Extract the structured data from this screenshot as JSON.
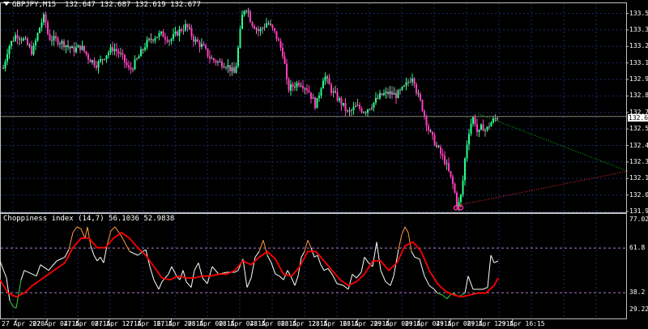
{
  "main_header": {
    "symbol": "GBPJPY,M15",
    "ohlc": "132.647 132.687 132.619 132.677"
  },
  "sub_header": {
    "indicator": "Choppiness index (14,7) 56.1036 52.9838"
  },
  "current_price": "132.677",
  "chart_data": [
    {
      "type": "candlestick",
      "title": "GBPJPY,M15",
      "y_ticks": [
        "133.520",
        "133.385",
        "133.250",
        "133.115",
        "132.980",
        "132.845",
        "132.710",
        "132.575",
        "132.440",
        "132.305",
        "132.170",
        "132.035",
        "131.900"
      ],
      "ylim": [
        131.9,
        133.59
      ],
      "approx_close_path": [
        [
          0,
          132.96
        ],
        [
          10,
          133.24
        ],
        [
          20,
          133.35
        ],
        [
          30,
          133.3
        ],
        [
          40,
          133.2
        ],
        [
          50,
          133.43
        ],
        [
          55,
          133.5
        ],
        [
          60,
          133.32
        ],
        [
          70,
          133.3
        ],
        [
          80,
          133.27
        ],
        [
          90,
          133.22
        ],
        [
          100,
          133.25
        ],
        [
          110,
          133.15
        ],
        [
          120,
          133.1
        ],
        [
          130,
          133.18
        ],
        [
          140,
          133.24
        ],
        [
          150,
          133.17
        ],
        [
          160,
          133.05
        ],
        [
          170,
          133.15
        ],
        [
          180,
          133.27
        ],
        [
          190,
          133.33
        ],
        [
          200,
          133.35
        ],
        [
          210,
          133.3
        ],
        [
          220,
          133.37
        ],
        [
          230,
          133.42
        ],
        [
          240,
          133.3
        ],
        [
          250,
          133.25
        ],
        [
          260,
          133.15
        ],
        [
          270,
          133.12
        ],
        [
          280,
          133.1
        ],
        [
          290,
          133.02
        ],
        [
          300,
          133.55
        ],
        [
          305,
          133.57
        ],
        [
          310,
          133.45
        ],
        [
          320,
          133.37
        ],
        [
          330,
          133.45
        ],
        [
          340,
          133.35
        ],
        [
          350,
          133.18
        ],
        [
          355,
          132.9
        ],
        [
          360,
          132.92
        ],
        [
          370,
          132.96
        ],
        [
          380,
          132.9
        ],
        [
          390,
          132.76
        ],
        [
          400,
          133.02
        ],
        [
          410,
          132.88
        ],
        [
          420,
          132.8
        ],
        [
          430,
          132.7
        ],
        [
          440,
          132.76
        ],
        [
          450,
          132.72
        ],
        [
          460,
          132.78
        ],
        [
          470,
          132.85
        ],
        [
          480,
          132.87
        ],
        [
          490,
          132.85
        ],
        [
          500,
          132.92
        ],
        [
          510,
          133.02
        ],
        [
          515,
          132.86
        ],
        [
          520,
          132.78
        ],
        [
          530,
          132.55
        ],
        [
          540,
          132.42
        ],
        [
          550,
          132.3
        ],
        [
          560,
          132.1
        ],
        [
          565,
          131.93
        ],
        [
          570,
          132.05
        ],
        [
          575,
          132.4
        ],
        [
          580,
          132.6
        ],
        [
          585,
          132.68
        ],
        [
          590,
          132.52
        ],
        [
          595,
          132.6
        ],
        [
          600,
          132.56
        ],
        [
          605,
          132.62
        ],
        [
          610,
          132.65
        ],
        [
          615,
          132.68
        ]
      ],
      "trendlines": [
        {
          "color": "#00cc00",
          "style": "dotted",
          "from": [
            590,
            132.7
          ],
          "to": [
            775,
            132.23
          ]
        },
        {
          "color": "#ff3333",
          "style": "dotted",
          "from": [
            565,
            131.95
          ],
          "to": [
            775,
            132.23
          ]
        }
      ],
      "markers": [
        {
          "x": 563,
          "y": 131.93,
          "color": "#ff2d9b"
        },
        {
          "x": 569,
          "y": 131.93,
          "color": "#ff2d9b"
        }
      ]
    },
    {
      "type": "line",
      "title": "Choppiness index (14,7)",
      "y_ticks": [
        "77.0261",
        "61.8",
        "38.2",
        "29.2276"
      ],
      "ylim": [
        25.0,
        79.0
      ],
      "levels": [
        61.8,
        38.2
      ],
      "series": [
        {
          "name": "CHOP (14)",
          "color": "#ffffff",
          "points": [
            [
              0,
              55
            ],
            [
              8,
              46
            ],
            [
              12,
              34
            ],
            [
              16,
              31
            ],
            [
              20,
              30
            ],
            [
              26,
              45
            ],
            [
              30,
              50
            ],
            [
              40,
              48
            ],
            [
              45,
              47
            ],
            [
              50,
              53
            ],
            [
              60,
              50
            ],
            [
              70,
              55
            ],
            [
              80,
              57
            ],
            [
              85,
              61
            ],
            [
              90,
              70
            ],
            [
              95,
              73
            ],
            [
              100,
              72
            ],
            [
              105,
              67
            ],
            [
              108,
              73
            ],
            [
              112,
              63
            ],
            [
              116,
              58
            ],
            [
              120,
              55
            ],
            [
              124,
              57
            ],
            [
              128,
              54
            ],
            [
              132,
              63
            ],
            [
              137,
              71
            ],
            [
              142,
              73
            ],
            [
              150,
              68
            ],
            [
              160,
              60
            ],
            [
              170,
              58
            ],
            [
              180,
              61
            ],
            [
              185,
              52
            ],
            [
              190,
              45
            ],
            [
              196,
              40
            ],
            [
              200,
              44
            ],
            [
              208,
              48
            ],
            [
              212,
              52
            ],
            [
              218,
              47
            ],
            [
              222,
              45
            ],
            [
              226,
              50
            ],
            [
              230,
              44
            ],
            [
              236,
              41
            ],
            [
              240,
              50
            ],
            [
              245,
              54
            ],
            [
              250,
              46
            ],
            [
              256,
              43
            ],
            [
              262,
              52
            ],
            [
              270,
              48
            ],
            [
              280,
              49
            ],
            [
              290,
              49
            ],
            [
              294,
              50
            ],
            [
              300,
              56
            ],
            [
              305,
              41
            ],
            [
              310,
              46
            ],
            [
              315,
              57
            ],
            [
              320,
              60
            ],
            [
              325,
              66
            ],
            [
              330,
              58
            ],
            [
              335,
              54
            ],
            [
              340,
              48
            ],
            [
              345,
              47
            ],
            [
              350,
              45
            ],
            [
              355,
              50
            ],
            [
              360,
              46
            ],
            [
              364,
              42
            ],
            [
              368,
              47
            ],
            [
              372,
              57
            ],
            [
              376,
              60
            ],
            [
              380,
              66
            ],
            [
              384,
              62
            ],
            [
              388,
              57
            ],
            [
              392,
              58
            ],
            [
              396,
              53
            ],
            [
              400,
              50
            ],
            [
              405,
              51
            ],
            [
              410,
              48
            ],
            [
              416,
              43
            ],
            [
              424,
              42
            ],
            [
              430,
              40
            ],
            [
              435,
              48
            ],
            [
              440,
              46
            ],
            [
              446,
              49
            ],
            [
              450,
              57
            ],
            [
              455,
              54
            ],
            [
              460,
              52
            ],
            [
              465,
              65
            ],
            [
              470,
              50
            ],
            [
              476,
              44
            ],
            [
              482,
              42
            ],
            [
              486,
              47
            ],
            [
              492,
              61
            ],
            [
              496,
              69
            ],
            [
              500,
              73
            ],
            [
              504,
              70
            ],
            [
              508,
              60
            ],
            [
              512,
              57
            ],
            [
              518,
              56
            ],
            [
              524,
              47
            ],
            [
              530,
              42
            ],
            [
              536,
              40
            ],
            [
              540,
              38
            ],
            [
              546,
              37
            ],
            [
              552,
              35
            ],
            [
              556,
              37
            ],
            [
              560,
              38
            ],
            [
              566,
              36
            ],
            [
              570,
              37
            ],
            [
              574,
              38
            ],
            [
              578,
              47
            ],
            [
              584,
              40
            ],
            [
              590,
              40
            ],
            [
              596,
              40
            ],
            [
              602,
              41
            ],
            [
              606,
              58
            ],
            [
              610,
              54
            ],
            [
              615,
              55
            ]
          ]
        },
        {
          "name": "Signal (7)",
          "color": "#ff0000",
          "points": [
            [
              0,
              45
            ],
            [
              10,
              38
            ],
            [
              20,
              36
            ],
            [
              30,
              38
            ],
            [
              40,
              42
            ],
            [
              50,
              45
            ],
            [
              60,
              48
            ],
            [
              70,
              51
            ],
            [
              80,
              54
            ],
            [
              90,
              62
            ],
            [
              100,
              67
            ],
            [
              110,
              67
            ],
            [
              120,
              62
            ],
            [
              130,
              62
            ],
            [
              140,
              67
            ],
            [
              150,
              70
            ],
            [
              160,
              67
            ],
            [
              170,
              62
            ],
            [
              180,
              58
            ],
            [
              190,
              52
            ],
            [
              200,
              46
            ],
            [
              210,
              45
            ],
            [
              220,
              47
            ],
            [
              230,
              46
            ],
            [
              240,
              46
            ],
            [
              250,
              47
            ],
            [
              260,
              47
            ],
            [
              270,
              48
            ],
            [
              280,
              48
            ],
            [
              290,
              50
            ],
            [
              300,
              55
            ],
            [
              310,
              53
            ],
            [
              320,
              57
            ],
            [
              330,
              60
            ],
            [
              340,
              56
            ],
            [
              350,
              48
            ],
            [
              360,
              47
            ],
            [
              370,
              52
            ],
            [
              380,
              60
            ],
            [
              390,
              60
            ],
            [
              400,
              55
            ],
            [
              410,
              50
            ],
            [
              420,
              45
            ],
            [
              430,
              42
            ],
            [
              440,
              44
            ],
            [
              450,
              48
            ],
            [
              460,
              55
            ],
            [
              470,
              55
            ],
            [
              480,
              50
            ],
            [
              490,
              54
            ],
            [
              500,
              63
            ],
            [
              510,
              65
            ],
            [
              520,
              60
            ],
            [
              530,
              50
            ],
            [
              540,
              43
            ],
            [
              550,
              39
            ],
            [
              560,
              37
            ],
            [
              570,
              36
            ],
            [
              580,
              37
            ],
            [
              590,
              38
            ],
            [
              600,
              38
            ],
            [
              610,
              42
            ],
            [
              615,
              46
            ]
          ]
        }
      ]
    }
  ],
  "time_axis": [
    "27 Apr 2020",
    "27 Apr 04:15",
    "27 Apr 08:15",
    "27 Apr 12:15",
    "27 Apr 16:15",
    "27 Apr 20:15",
    "28 Apr 00:15",
    "28 Apr 04:15",
    "28 Apr 08:15",
    "28 Apr 12:15",
    "28 Apr 16:15",
    "28 Apr 20:15",
    "29 Apr 00:15",
    "29 Apr 04:15",
    "29 Apr 08:15",
    "29 Apr 12:15",
    "29 Apr 16:15"
  ]
}
